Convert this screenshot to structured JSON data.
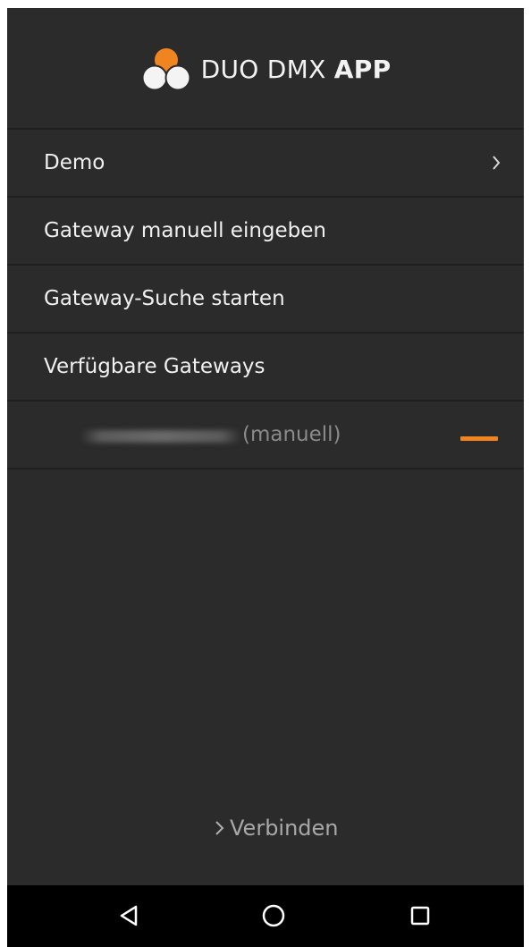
{
  "header": {
    "app_name_light": "DUO DMX ",
    "app_name_bold": "APP",
    "logo_icon": "three-circles-logo-icon",
    "accent_color": "#f0841f"
  },
  "menu": {
    "items": [
      {
        "label": "Demo",
        "icon": "chevron-right-icon"
      },
      {
        "label": "Gateway manuell eingeben"
      },
      {
        "label": "Gateway-Suche starten"
      },
      {
        "label": "Verfügbare Gateways"
      }
    ]
  },
  "gateways": [
    {
      "tag": "(manuell)",
      "remove_icon": "minus-icon"
    }
  ],
  "footer": {
    "connect_label": "Verbinden",
    "connect_icon": "chevron-right-icon"
  },
  "navbar": {
    "back_icon": "back-triangle-icon",
    "home_icon": "home-circle-icon",
    "recents_icon": "recents-square-icon"
  }
}
